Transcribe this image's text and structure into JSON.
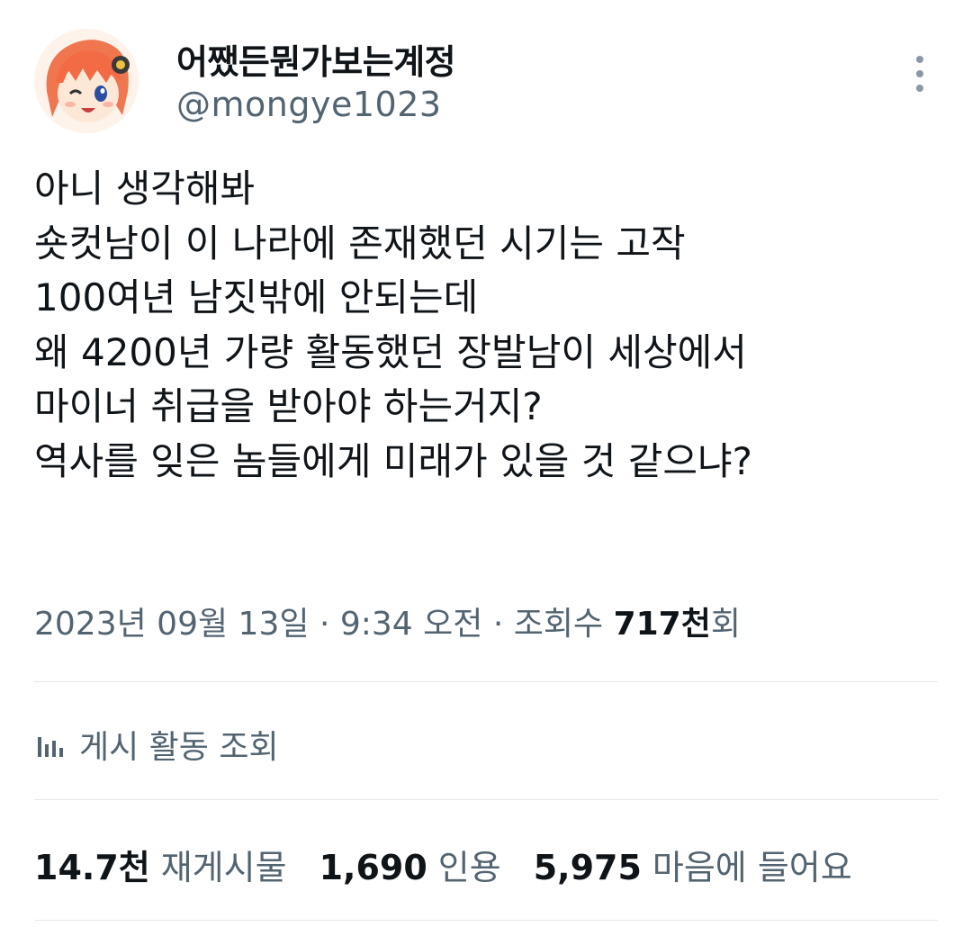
{
  "profile": {
    "display_name": "어쨌든뭔가보는계정",
    "handle": "@mongye1023",
    "avatar_icon": "anime-character-avatar"
  },
  "more_icon": "more-vertical-icon",
  "tweet": {
    "lines": [
      "아니 생각해봐",
      "숏컷남이 이 나라에 존재했던 시기는 고작",
      "100여년 남짓밖에 안되는데",
      "왜 4200년 가량 활동했던 장발남이 세상에서",
      "마이너 취급을 받아야 하는거지?",
      "역사를 잊은 놈들에게 미래가 있을 것 같으냐?"
    ]
  },
  "meta": {
    "date": "2023년 09월 13일",
    "separator": "·",
    "time": "9:34 오전",
    "views_label_prefix": "조회수",
    "views_count": "717천",
    "views_label_suffix": "회"
  },
  "activity": {
    "icon": "analytics-bar-chart-icon",
    "label": "게시 활동 조회"
  },
  "stats": {
    "reposts": {
      "count": "14.7천",
      "label": "재게시물"
    },
    "quotes": {
      "count": "1,690",
      "label": "인용"
    },
    "likes": {
      "count": "5,975",
      "label": "마음에 들어요"
    }
  },
  "colors": {
    "text_primary": "#0f1419",
    "text_secondary": "#536471",
    "divider": "#e1e8ed"
  }
}
